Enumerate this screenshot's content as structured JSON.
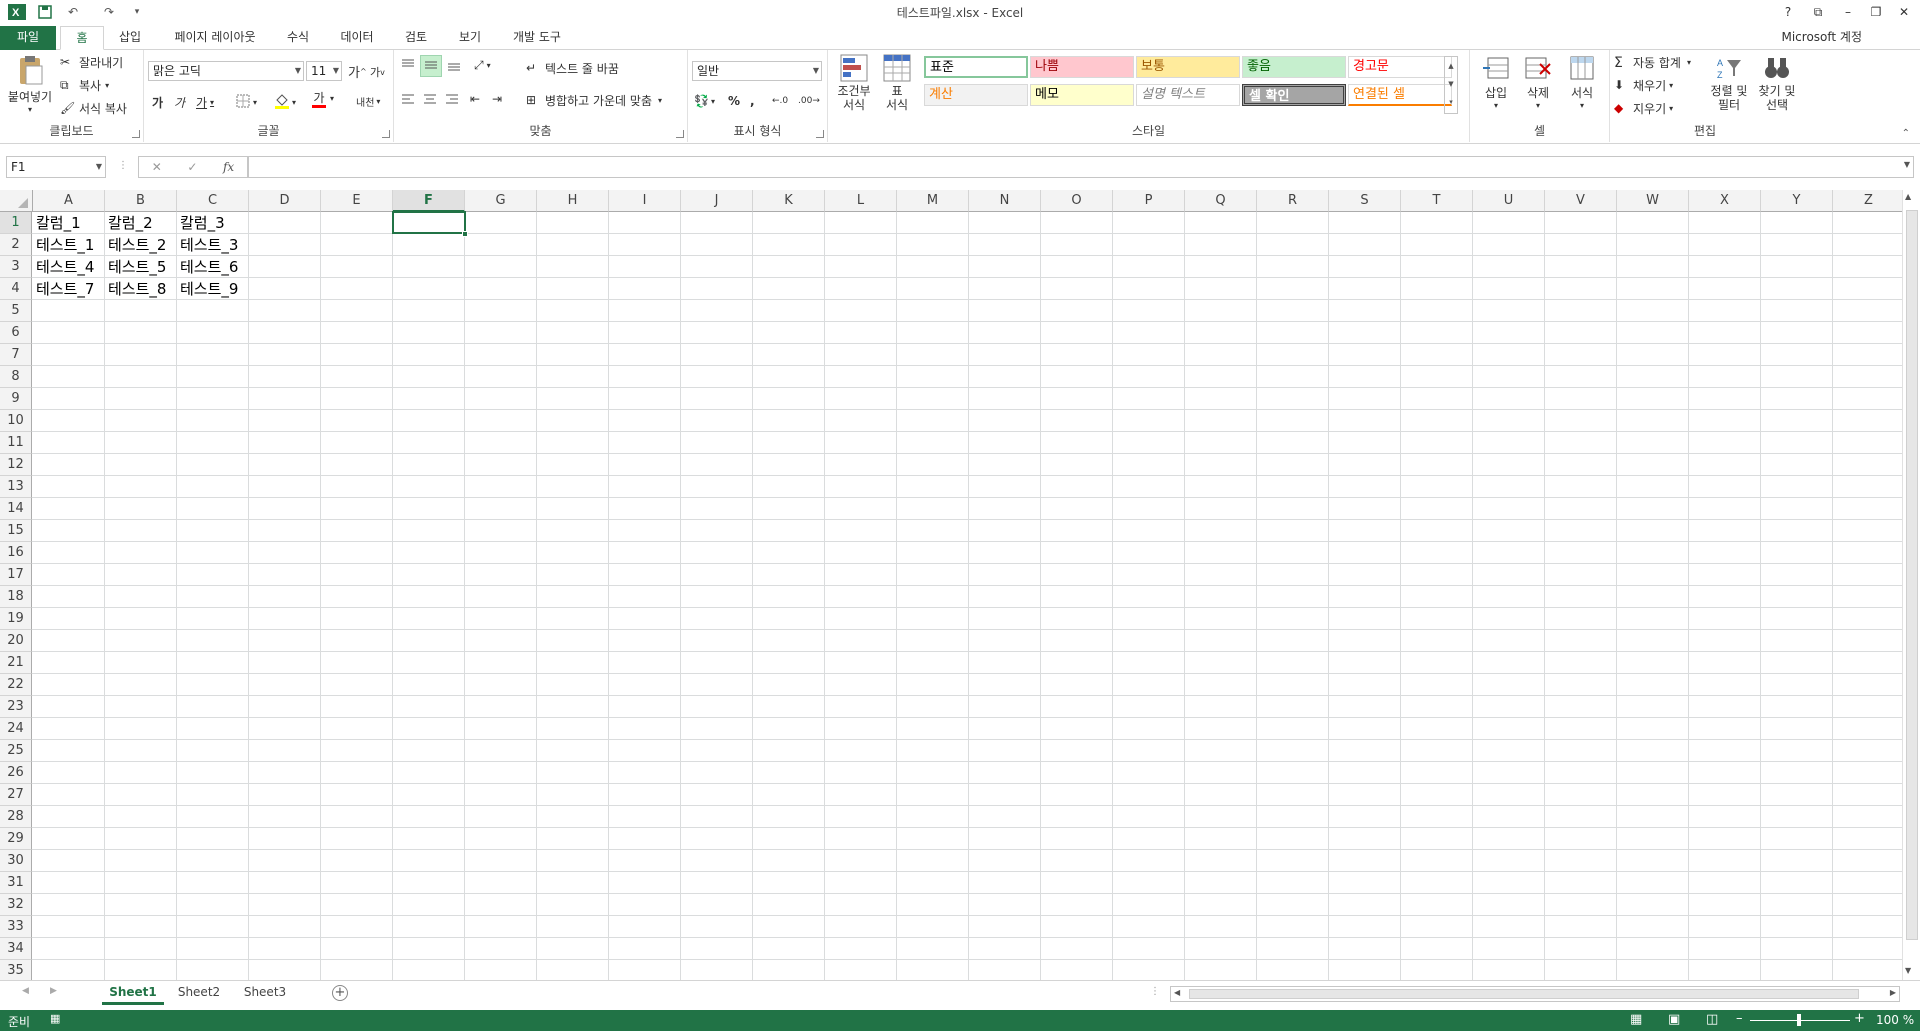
{
  "window": {
    "title": "테스트파일.xlsx - Excel",
    "help": "?",
    "minimize": "–",
    "restore": "❐",
    "close": "✕",
    "ribbon_display": "⧉"
  },
  "account": {
    "label": "Microsoft 계정"
  },
  "tabs": [
    {
      "label": "파일"
    },
    {
      "label": "홈"
    },
    {
      "label": "삽입"
    },
    {
      "label": "페이지 레이아웃"
    },
    {
      "label": "수식"
    },
    {
      "label": "데이터"
    },
    {
      "label": "검토"
    },
    {
      "label": "보기"
    },
    {
      "label": "개발 도구"
    }
  ],
  "clipboard": {
    "paste": "붙여넣기",
    "cut": "잘라내기",
    "copy": "복사",
    "format_painter": "서식 복사",
    "group": "클립보드"
  },
  "font": {
    "name": "맑은 고딕",
    "size": "11",
    "grow": "가",
    "shrink": "가",
    "bold": "가",
    "italic": "가",
    "underline": "가",
    "color_letter": "가",
    "phonetic": "내천",
    "group": "글꼴"
  },
  "alignment": {
    "wrap": "텍스트 줄 바꿈",
    "merge": "병합하고 가운데 맞춤",
    "group": "맞춤"
  },
  "number": {
    "format": "일반",
    "percent": "%",
    "comma": ",",
    "group": "표시 형식"
  },
  "styles": {
    "conditional": [
      "조건부",
      "서식"
    ],
    "table": [
      "표",
      "서식"
    ],
    "cells": [
      {
        "label": "표준",
        "bg": "#ffffff",
        "fg": "#000000"
      },
      {
        "label": "나쁨",
        "bg": "#ffc7ce",
        "fg": "#9c0006"
      },
      {
        "label": "보통",
        "bg": "#ffeb9c",
        "fg": "#9c5700"
      },
      {
        "label": "좋음",
        "bg": "#c6efce",
        "fg": "#006100"
      },
      {
        "label": "경고문",
        "bg": "#ffffff",
        "fg": "#ff0000"
      },
      {
        "label": "계산",
        "bg": "#f2f2f2",
        "fg": "#fa7d00"
      },
      {
        "label": "메모",
        "bg": "#ffffcc",
        "fg": "#000000"
      },
      {
        "label": "설명 텍스트",
        "bg": "#ffffff",
        "fg": "#7f7f7f"
      },
      {
        "label": "셀 확인",
        "bg": "#a5a5a5",
        "fg": "#ffffff"
      },
      {
        "label": "연결된 셀",
        "bg": "#ffffff",
        "fg": "#fa7d00"
      }
    ],
    "group": "스타일"
  },
  "cells_group": {
    "insert": "삽입",
    "delete": "삭제",
    "format": "서식",
    "group": "셀"
  },
  "editing": {
    "autosum": "자동 합계",
    "fill": "채우기",
    "clear": "지우기",
    "sort": [
      "정렬 및",
      "필터"
    ],
    "find": [
      "찾기 및",
      "선택"
    ],
    "group": "편집"
  },
  "formula_bar": {
    "name_box": "F1",
    "fx": "fx",
    "cancel": "✕",
    "enter": "✓",
    "value": ""
  },
  "columns": [
    "A",
    "B",
    "C",
    "D",
    "E",
    "F",
    "G",
    "H",
    "I",
    "J",
    "K",
    "L",
    "M",
    "N",
    "O",
    "P",
    "Q",
    "R",
    "S",
    "T",
    "U",
    "V",
    "W",
    "X",
    "Y",
    "Z"
  ],
  "selected_column": "F",
  "rows": [
    "1",
    "2",
    "3",
    "4",
    "5",
    "6",
    "7",
    "8",
    "9",
    "10",
    "11",
    "12",
    "13",
    "14",
    "15",
    "16",
    "17",
    "18",
    "19",
    "20",
    "21",
    "22",
    "23",
    "24",
    "25",
    "26",
    "27",
    "28",
    "29",
    "30",
    "31",
    "32",
    "33",
    "34",
    "35"
  ],
  "cells": [
    [
      "칼럼_1",
      "칼럼_2",
      "칼럼_3"
    ],
    [
      "테스트_1",
      "테스트_2",
      "테스트_3"
    ],
    [
      "테스트_4",
      "테스트_5",
      "테스트_6"
    ],
    [
      "테스트_7",
      "테스트_8",
      "테스트_9"
    ]
  ],
  "sheets": [
    {
      "label": "Sheet1"
    },
    {
      "label": "Sheet2"
    },
    {
      "label": "Sheet3"
    }
  ],
  "active_sheet": "Sheet1",
  "status": {
    "ready": "준비",
    "zoom": "100 %"
  },
  "colors": {
    "accent": "#217346"
  }
}
